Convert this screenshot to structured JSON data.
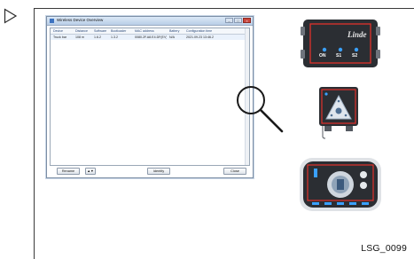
{
  "figure": {
    "code": "LSG_0099"
  },
  "window": {
    "title": "Wireless Device Overview",
    "controls": [
      "–",
      "□",
      "×"
    ],
    "columns": [
      "Device",
      "Distance",
      "Software",
      "Bootloader",
      "MAC address",
      "Battery",
      "Configuration time"
    ],
    "rows": [
      [
        "Truck bar",
        "108 m",
        "1.6.2",
        "1.3.2",
        "0080.2F.A8.E4.DF(EV)",
        "N/A",
        "2021.09.23 13:46.2"
      ]
    ],
    "buttons": {
      "rename": "Rename",
      "dropdown": "▲▼",
      "identify": "Identify",
      "close": "Close"
    }
  },
  "devices": {
    "box_brand": "Linde",
    "box_labels": [
      "ON",
      "S1",
      "S2"
    ]
  },
  "icons": {
    "marker": "play-triangle-icon",
    "zoom": "magnifier-icon",
    "warning": "warning-triangle-icon"
  },
  "colors": {
    "accent_red": "#e0312b",
    "device_dark": "#2b2e33",
    "window_border": "#7c8ea5"
  }
}
